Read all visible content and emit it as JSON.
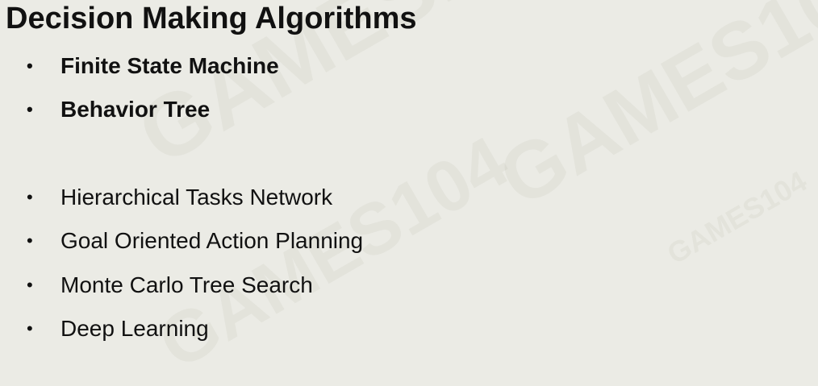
{
  "slide": {
    "title": "Decision Making Algorithms",
    "bullet_symbol": "•",
    "primary_items": [
      {
        "label": "Finite State Machine"
      },
      {
        "label": "Behavior Tree"
      }
    ],
    "secondary_items": [
      {
        "label": "Hierarchical Tasks Network"
      },
      {
        "label": "Goal Oriented Action Planning"
      },
      {
        "label": "Monte Carlo Tree Search"
      },
      {
        "label": "Deep Learning"
      }
    ],
    "watermark_text": "GAMES104",
    "colors": {
      "background": "#ebebe5",
      "text": "#111111"
    }
  }
}
